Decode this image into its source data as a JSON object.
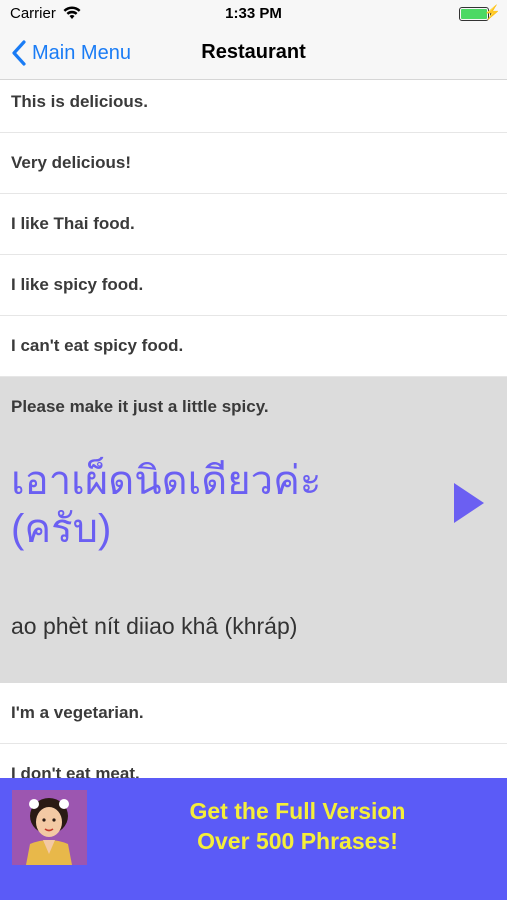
{
  "status": {
    "carrier": "Carrier",
    "time": "1:33 PM"
  },
  "nav": {
    "back_label": "Main Menu",
    "title": "Restaurant"
  },
  "phrases": [
    "This is delicious.",
    "Very delicious!",
    "I like Thai food.",
    "I like spicy food.",
    "I can't eat spicy food."
  ],
  "expanded": {
    "english": "Please make it just a little spicy.",
    "thai": "เอาเผ็ดนิดเดียวค่ะ (ครับ)",
    "romanization": "ao phèt nít diiao khâ (khráp)"
  },
  "phrases_after": [
    "I'm a vegetarian.",
    "I don't eat meat."
  ],
  "banner": {
    "line1": "Get the Full Version",
    "line2": "Over 500 Phrases!"
  },
  "colors": {
    "accent": "#1a7cf5",
    "thai": "#6b5ff2",
    "banner_bg": "#5b5bf7",
    "banner_text": "#f5ee3a"
  }
}
